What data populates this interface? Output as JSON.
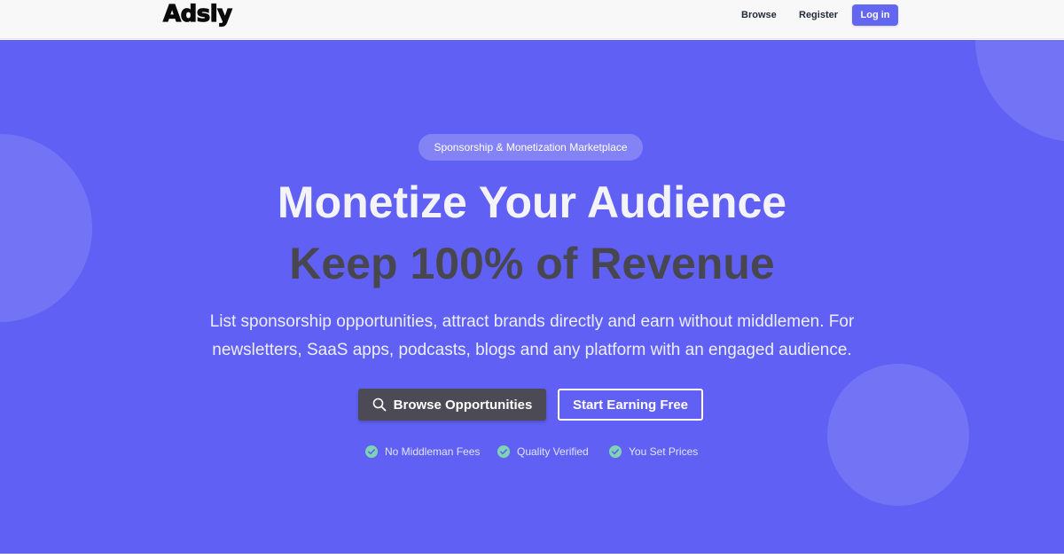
{
  "nav": {
    "logo": "Adsly",
    "links": [
      {
        "label": "Browse"
      },
      {
        "label": "Register"
      }
    ],
    "login_label": "Log in"
  },
  "hero": {
    "badge": "Sponsorship & Monetization Marketplace",
    "headline_line1": "Monetize Your Audience",
    "headline_line2": "Keep 100% of Revenue",
    "subtitle_line1": "List sponsorship opportunities, attract brands directly and earn without middlemen. For",
    "subtitle_line2": "newsletters, SaaS apps, podcasts, blogs and any platform with an engaged audience.",
    "primary_button": "Browse Opportunities",
    "secondary_button": "Start Earning Free",
    "features": [
      {
        "label": "No Middleman Fees",
        "icon": "check-circle-icon"
      },
      {
        "label": "Quality Verified",
        "icon": "check-circle-icon"
      },
      {
        "label": "You Set Prices",
        "icon": "check-circle-icon"
      }
    ]
  },
  "colors": {
    "hero_background": "#6061f4",
    "accent": "#6366f1",
    "primary_button": "#4b4a55",
    "check": "#7fd3b4"
  }
}
